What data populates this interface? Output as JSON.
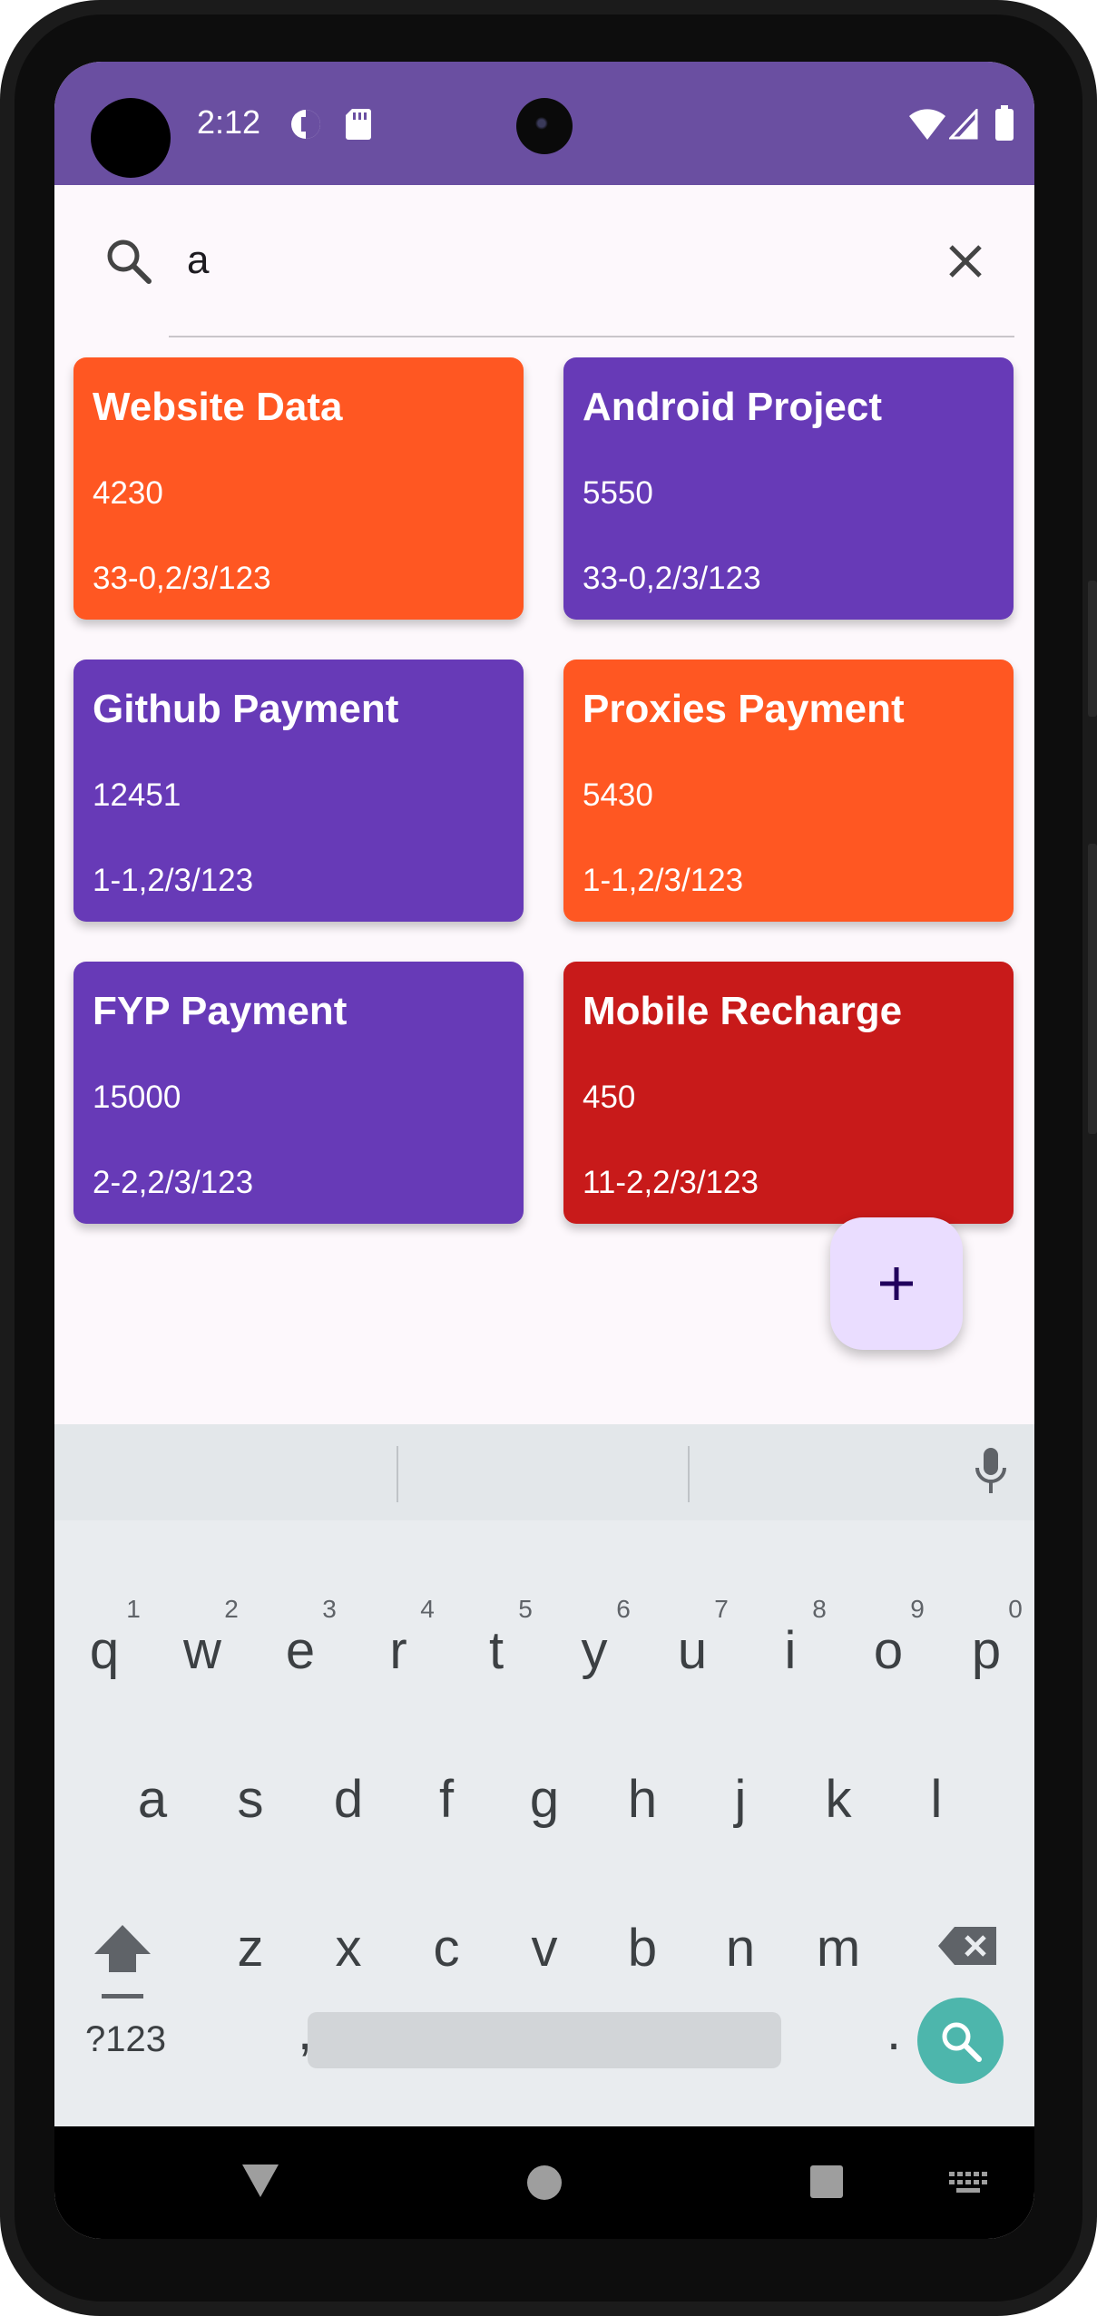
{
  "status_bar": {
    "time": "2:12"
  },
  "search": {
    "query": "a"
  },
  "cards": [
    {
      "title": "Website Data",
      "amount": "4230",
      "date": "33-0,2/3/123",
      "color": "#ff5722"
    },
    {
      "title": "Android Project",
      "amount": "5550",
      "date": "33-0,2/3/123",
      "color": "#673ab7"
    },
    {
      "title": "Github Payment",
      "amount": "12451",
      "date": "1-1,2/3/123",
      "color": "#673ab7"
    },
    {
      "title": "Proxies Payment",
      "amount": "5430",
      "date": "1-1,2/3/123",
      "color": "#ff5722"
    },
    {
      "title": "FYP Payment",
      "amount": "15000",
      "date": "2-2,2/3/123",
      "color": "#673ab7"
    },
    {
      "title": "Mobile Recharge",
      "amount": "450",
      "date": "11-2,2/3/123",
      "color": "#c81a1a"
    }
  ],
  "keyboard": {
    "row1": [
      "q",
      "w",
      "e",
      "r",
      "t",
      "y",
      "u",
      "i",
      "o",
      "p"
    ],
    "hints": [
      "1",
      "2",
      "3",
      "4",
      "5",
      "6",
      "7",
      "8",
      "9",
      "0"
    ],
    "row2": [
      "a",
      "s",
      "d",
      "f",
      "g",
      "h",
      "j",
      "k",
      "l"
    ],
    "row3": [
      "z",
      "x",
      "c",
      "v",
      "b",
      "n",
      "m"
    ],
    "symbols_label": "?123",
    "comma": ",",
    "period": "."
  },
  "colors": {
    "status_bar": "#6a4fa1",
    "fab": "#eaddff",
    "search_key": "#4db6ac"
  }
}
